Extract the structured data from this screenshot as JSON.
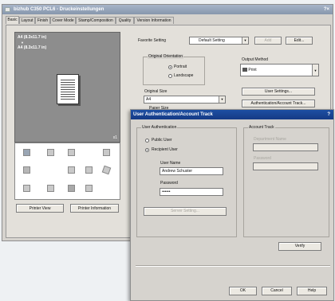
{
  "main_window": {
    "title": "bizhub C350 PCL6 - Druckeinstellungen",
    "tabs": [
      "Basic",
      "Layout",
      "Finish",
      "Cover Mode",
      "Stamp/Composition",
      "Quality",
      "Version Information"
    ],
    "preview_text_1": "A4 (8.3x11.7 in)",
    "preview_arrow": "▼",
    "preview_text_2": "A4 (8.3x11.7 in)",
    "page_count": "x1",
    "printer_view_button": "Printer View",
    "printer_information_button": "Printer Information",
    "favorite_setting_label": "Favorite Setting",
    "favorite_setting_value": "Default Setting",
    "add_button": "Add",
    "edit_button": "Edit...",
    "original_orientation_label": "Original Orientation",
    "orientation_options": [
      "Portrait",
      "Landscape"
    ],
    "orientation_selected": 0,
    "output_method_label": "Output Method",
    "output_method_value": "Print",
    "original_size_label": "Original Size",
    "original_size_value": "A4",
    "paper_size_label": "Paper Size",
    "user_settings_button": "User Settings...",
    "auth_account_track_button": "Authentication/Account Track..."
  },
  "dialog": {
    "title": "User Authentication/Account Track",
    "help_glyph": "?",
    "user_auth_group": "User Authentication",
    "public_user": "Public User",
    "recipient_user": "Recipient User",
    "selected": "recipient",
    "user_name_label": "User Name",
    "user_name_value": "Andrew Schuster",
    "password_label": "Password",
    "password_value": "••••••",
    "server_setting_button": "Server Setting...",
    "account_track_group": "Account Track",
    "department_name_label": "Department Name",
    "account_password_label": "Password",
    "verify_button": "Verify",
    "ok_button": "OK",
    "cancel_button": "Cancel",
    "help_button": "Help"
  },
  "colors": {
    "titlebar": "#1d4fa3",
    "window_face": "#d6d3ce",
    "preview_bg": "#8d8d8d"
  }
}
